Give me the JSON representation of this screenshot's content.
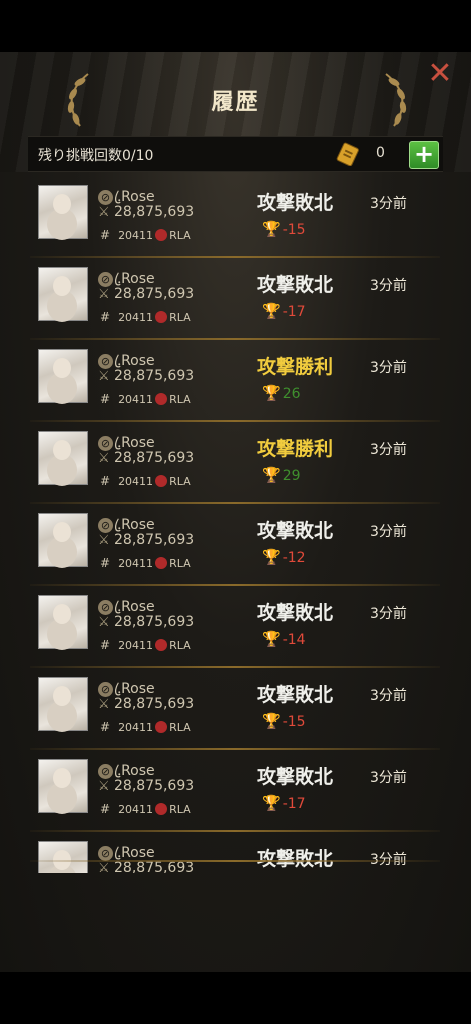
{
  "header": {
    "title": "履歴",
    "close_icon": "close-icon"
  },
  "info": {
    "remaining_label": "残り挑戦回数0/10",
    "ticket_count": "0",
    "add_label": "+"
  },
  "history": [
    {
      "name": ".ꦿRose",
      "power": "28,875,693",
      "guild_id": "20411",
      "guild_tag": "RLA",
      "result": "攻撃敗北",
      "outcome": "lose",
      "score": "-15",
      "time": "3分前"
    },
    {
      "name": ".ꦿRose",
      "power": "28,875,693",
      "guild_id": "20411",
      "guild_tag": "RLA",
      "result": "攻撃敗北",
      "outcome": "lose",
      "score": "-17",
      "time": "3分前"
    },
    {
      "name": ".ꦿRose",
      "power": "28,875,693",
      "guild_id": "20411",
      "guild_tag": "RLA",
      "result": "攻撃勝利",
      "outcome": "win",
      "score": "26",
      "time": "3分前"
    },
    {
      "name": ".ꦿRose",
      "power": "28,875,693",
      "guild_id": "20411",
      "guild_tag": "RLA",
      "result": "攻撃勝利",
      "outcome": "win",
      "score": "29",
      "time": "3分前"
    },
    {
      "name": ".ꦿRose",
      "power": "28,875,693",
      "guild_id": "20411",
      "guild_tag": "RLA",
      "result": "攻撃敗北",
      "outcome": "lose",
      "score": "-12",
      "time": "3分前"
    },
    {
      "name": ".ꦿRose",
      "power": "28,875,693",
      "guild_id": "20411",
      "guild_tag": "RLA",
      "result": "攻撃敗北",
      "outcome": "lose",
      "score": "-14",
      "time": "3分前"
    },
    {
      "name": ".ꦿRose",
      "power": "28,875,693",
      "guild_id": "20411",
      "guild_tag": "RLA",
      "result": "攻撃敗北",
      "outcome": "lose",
      "score": "-15",
      "time": "3分前"
    },
    {
      "name": ".ꦿRose",
      "power": "28,875,693",
      "guild_id": "20411",
      "guild_tag": "RLA",
      "result": "攻撃敗北",
      "outcome": "lose",
      "score": "-17",
      "time": "3分前"
    },
    {
      "name": ".ꦿRose",
      "power": "28,875,693",
      "guild_id": "",
      "guild_tag": "",
      "result": "攻撃敗北",
      "outcome": "lose",
      "score": "",
      "time": "3分前"
    }
  ],
  "colors": {
    "win": "#f1cc3e",
    "lose": "#efefea",
    "score_win": "#3f8f2e",
    "score_lose": "#e14a3a"
  }
}
